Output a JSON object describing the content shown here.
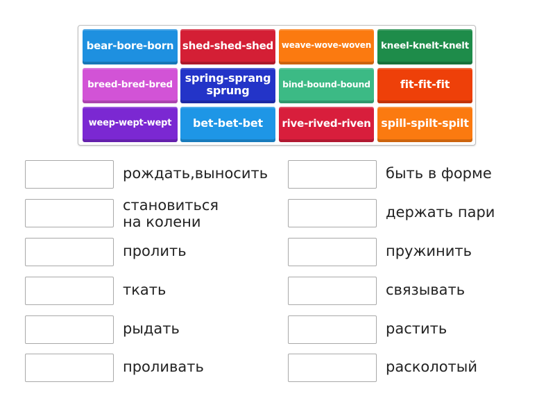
{
  "tiles": [
    {
      "label": "bear-bore-born",
      "color": "#1e90e0"
    },
    {
      "label": "shed-shed-shed",
      "color": "#d41f35"
    },
    {
      "label": "weave-wove-woven",
      "color": "#fb7a10"
    },
    {
      "label": "kneel-knelt-knelt",
      "color": "#1e8c4a"
    },
    {
      "label": "breed-bred-bred",
      "color": "#d253d6"
    },
    {
      "label": "spring-sprang sprung",
      "color": "#2334c8"
    },
    {
      "label": "bind-bound-bound",
      "color": "#3cba85"
    },
    {
      "label": "fit-fit-fit",
      "color": "#ee4009"
    },
    {
      "label": "weep-wept-wept",
      "color": "#7b28d2"
    },
    {
      "label": "bet-bet-bet",
      "color": "#1e96e6"
    },
    {
      "label": "rive-rived-riven",
      "color": "#d81e3c"
    },
    {
      "label": "spill-spilt-spilt",
      "color": "#fb7a10"
    }
  ],
  "left_targets": [
    {
      "label": "рождать,выносить"
    },
    {
      "label": "становиться\nна колени"
    },
    {
      "label": "пролить"
    },
    {
      "label": "ткать"
    },
    {
      "label": "рыдать"
    },
    {
      "label": "проливать"
    }
  ],
  "right_targets": [
    {
      "label": "быть в форме"
    },
    {
      "label": "держать пари"
    },
    {
      "label": "пружинить"
    },
    {
      "label": "связывать"
    },
    {
      "label": "растить"
    },
    {
      "label": "расколотый"
    }
  ]
}
